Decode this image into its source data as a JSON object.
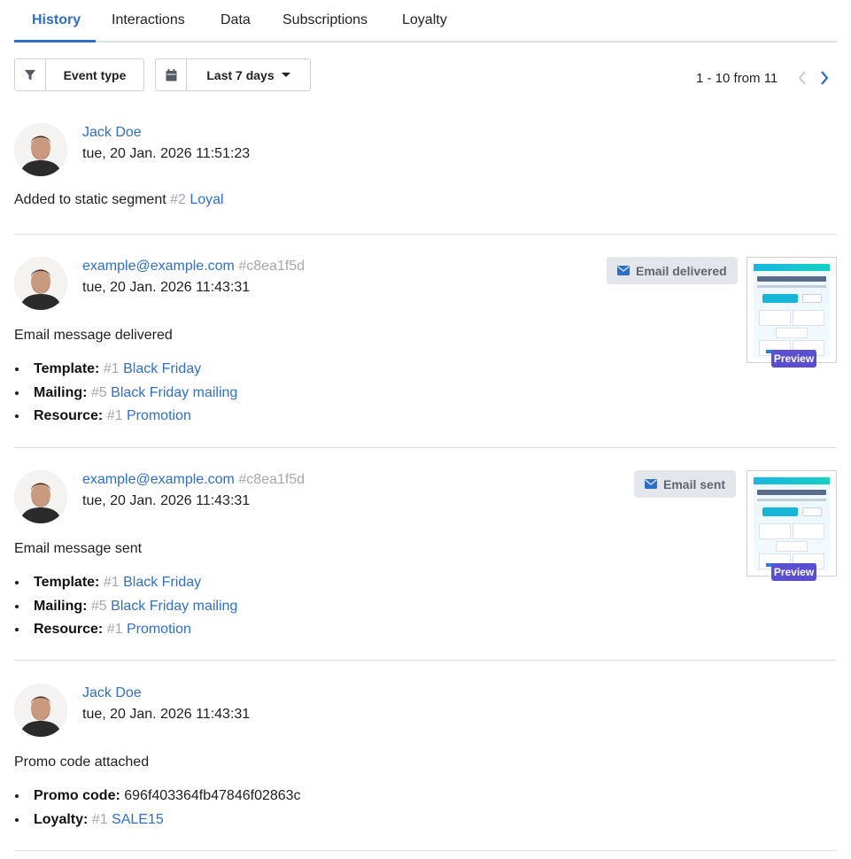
{
  "tabs": [
    {
      "label": "History"
    },
    {
      "label": "Interactions"
    },
    {
      "label": "Data"
    },
    {
      "label": "Subscriptions"
    },
    {
      "label": "Loyalty"
    }
  ],
  "filters": {
    "event_type_label": "Event type",
    "period_label": "Last 7 days"
  },
  "pager": {
    "text": "1 - 10 from 11"
  },
  "events": [
    {
      "actor": "Jack Doe",
      "timestamp": "tue, 20 Jan. 2026 11:51:23",
      "description_prefix": "Added to static segment",
      "segment_id": "#2",
      "segment_name": "Loyal"
    },
    {
      "actor": "example@example.com",
      "actor_id": "#c8ea1f5d",
      "timestamp": "tue, 20 Jan. 2026 11:43:31",
      "badge": "Email delivered",
      "preview_label": "Preview",
      "description": "Email message delivered",
      "props": [
        {
          "key": "Template:",
          "id": "#1",
          "value": "Black Friday"
        },
        {
          "key": "Mailing:",
          "id": "#5",
          "value": "Black Friday mailing"
        },
        {
          "key": "Resource:",
          "id": "#1",
          "value": "Promotion"
        }
      ]
    },
    {
      "actor": "example@example.com",
      "actor_id": "#c8ea1f5d",
      "timestamp": "tue, 20 Jan. 2026 11:43:31",
      "badge": "Email sent",
      "preview_label": "Preview",
      "description": "Email message sent",
      "props": [
        {
          "key": "Template:",
          "id": "#1",
          "value": "Black Friday"
        },
        {
          "key": "Mailing:",
          "id": "#5",
          "value": "Black Friday mailing"
        },
        {
          "key": "Resource:",
          "id": "#1",
          "value": "Promotion"
        }
      ]
    },
    {
      "actor": "Jack Doe",
      "timestamp": "tue, 20 Jan. 2026 11:43:31",
      "description": "Promo code attached",
      "props": [
        {
          "key": "Promo code:",
          "value": "696f403364fb47846f02863c"
        },
        {
          "key": "Loyalty:",
          "id": "#1",
          "value": "SALE15"
        }
      ]
    }
  ],
  "icons": {
    "filter": "funnel-icon",
    "calendar": "calendar-icon",
    "prev": "chevron-left-icon",
    "next": "chevron-right-icon",
    "badge": "envelope-icon"
  },
  "colors": {
    "accent": "#2f6fc7",
    "muted": "#a4a8ae",
    "badge_bg": "#e3e6ea",
    "preview_chip": "#5b4fd1"
  }
}
